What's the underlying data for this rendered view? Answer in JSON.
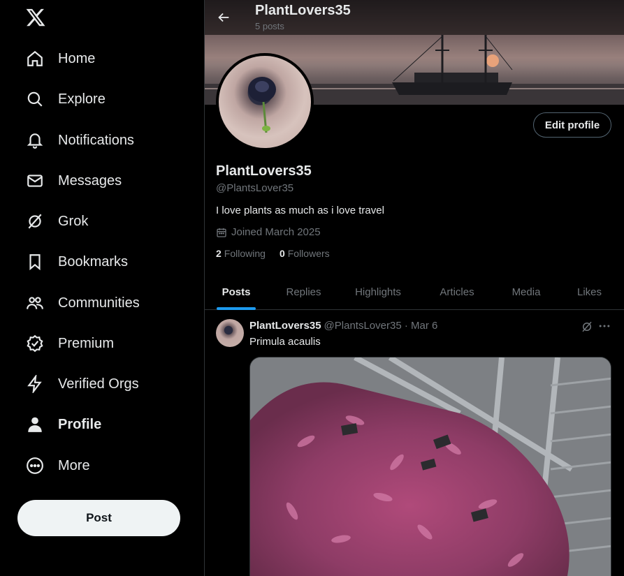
{
  "sidebar": {
    "items": [
      {
        "label": "Home",
        "icon": "home-icon"
      },
      {
        "label": "Explore",
        "icon": "search-icon"
      },
      {
        "label": "Notifications",
        "icon": "bell-icon"
      },
      {
        "label": "Messages",
        "icon": "envelope-icon"
      },
      {
        "label": "Grok",
        "icon": "grok-icon"
      },
      {
        "label": "Bookmarks",
        "icon": "bookmark-icon"
      },
      {
        "label": "Communities",
        "icon": "communities-icon"
      },
      {
        "label": "Premium",
        "icon": "verified-badge-icon"
      },
      {
        "label": "Verified Orgs",
        "icon": "lightning-icon"
      },
      {
        "label": "Profile",
        "icon": "person-icon"
      },
      {
        "label": "More",
        "icon": "more-circle-icon"
      }
    ],
    "post_label": "Post"
  },
  "header": {
    "title": "PlantLovers35",
    "subtitle": "5 posts"
  },
  "profile": {
    "edit_label": "Edit profile",
    "display_name": "PlantLovers35",
    "handle": "@PlantsLover35",
    "bio": "I love plants as much as i love travel",
    "joined": "Joined March 2025",
    "following_count": "2",
    "following_label": "Following",
    "followers_count": "0",
    "followers_label": "Followers"
  },
  "tabs": [
    {
      "label": "Posts",
      "active": true
    },
    {
      "label": "Replies"
    },
    {
      "label": "Highlights"
    },
    {
      "label": "Articles"
    },
    {
      "label": "Media"
    },
    {
      "label": "Likes"
    }
  ],
  "post": {
    "name": "PlantLovers35",
    "meta": "@PlantsLover35 · Mar 6",
    "text": "Primula acaulis"
  },
  "colors": {
    "accent": "#1d9bf0",
    "background": "#000000",
    "text_primary": "#e7e9ea",
    "text_secondary": "#71767b",
    "border": "#2f3336"
  }
}
